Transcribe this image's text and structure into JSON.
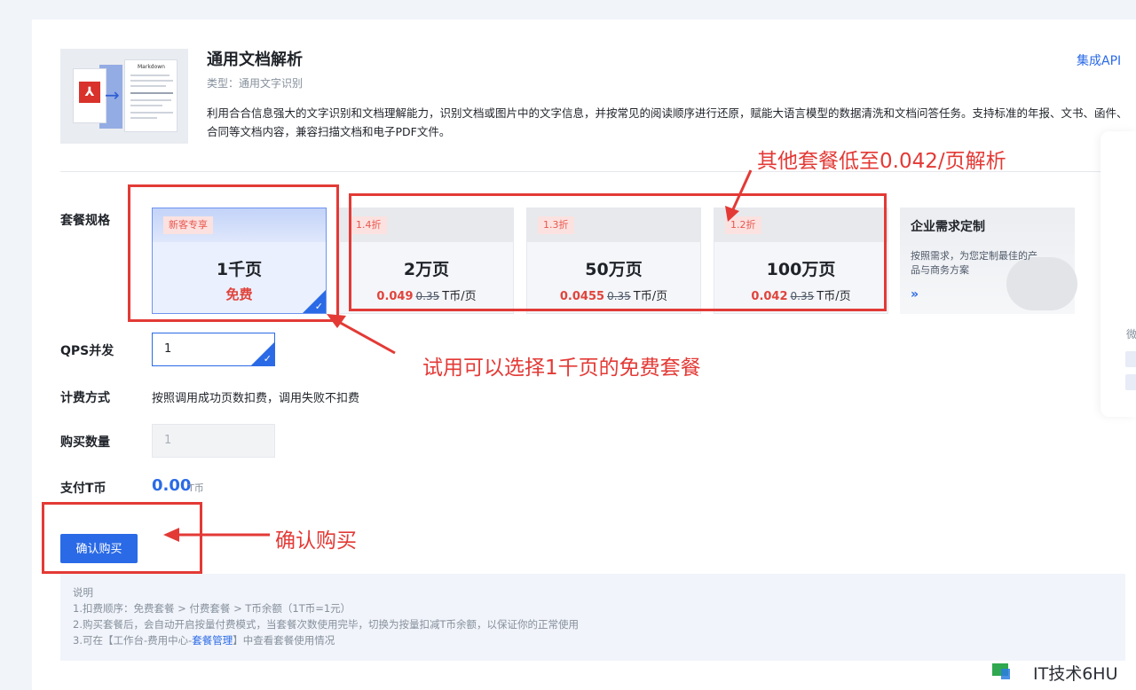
{
  "product": {
    "title": "通用文档解析",
    "type_label": "类型：通用文字识别",
    "description": "利用合合信息强大的文字识别和文档理解能力，识别文档或图片中的文字信息，并按常见的阅读顺序进行还原，赋能大语言模型的数据清洗和文档问答任务。支持标准的年报、文书、函件、合同等文档内容，兼容扫描文档和电子PDF文件。",
    "api_link": "集成API",
    "thumbnail_caption": "Markdown"
  },
  "form": {
    "package_label": "套餐规格",
    "qps_label": "QPS并发",
    "qps_value": "1",
    "billing_label": "计费方式",
    "billing_text": "按照调用成功页数扣费，调用失败不扣费",
    "quantity_label": "购买数量",
    "quantity_value": "1",
    "pay_label": "支付T币",
    "pay_amount": "0.00",
    "pay_unit": "T币",
    "buy_button": "确认购买"
  },
  "packages": [
    {
      "tag": "新客专享",
      "name": "1千页",
      "price": "免费",
      "selected": true
    },
    {
      "tag": "1.4折",
      "name": "2万页",
      "price_now": "0.049",
      "price_old": "0.35",
      "unit": "T币/页",
      "selected": false
    },
    {
      "tag": "1.3折",
      "name": "50万页",
      "price_now": "0.0455",
      "price_old": "0.35",
      "unit": "T币/页",
      "selected": false
    },
    {
      "tag": "1.2折",
      "name": "100万页",
      "price_now": "0.042",
      "price_old": "0.35",
      "unit": "T币/页",
      "selected": false
    }
  ],
  "enterprise": {
    "title": "企业需求定制",
    "desc": "按照需求，为您定制最佳的产品与商务方案",
    "more_icon": "»"
  },
  "notes": {
    "heading": "说明",
    "line1": "1.扣费顺序：免费套餐 > 付费套餐 > T币余额（1T币=1元）",
    "line2": "2.购买套餐后，会自动开启按量付费模式，当套餐次数使用完毕，切换为按量扣减T币余额，以保证你的正常使用",
    "line3_prefix": "3.可在【工作台-费用中心-",
    "line3_link": "套餐管理",
    "line3_suffix": "】中查看套餐使用情况"
  },
  "float_panel": {
    "char": "微"
  },
  "annotations": {
    "other_packages": "其他套餐低至0.042/页解析",
    "trial": "试用可以选择1千页的免费套餐",
    "confirm": "确认购买"
  },
  "watermark": "IT技术6HU",
  "colors": {
    "accent": "#2a6ae6",
    "price_red": "#e0443c",
    "annotation_red": "#e33a36"
  }
}
